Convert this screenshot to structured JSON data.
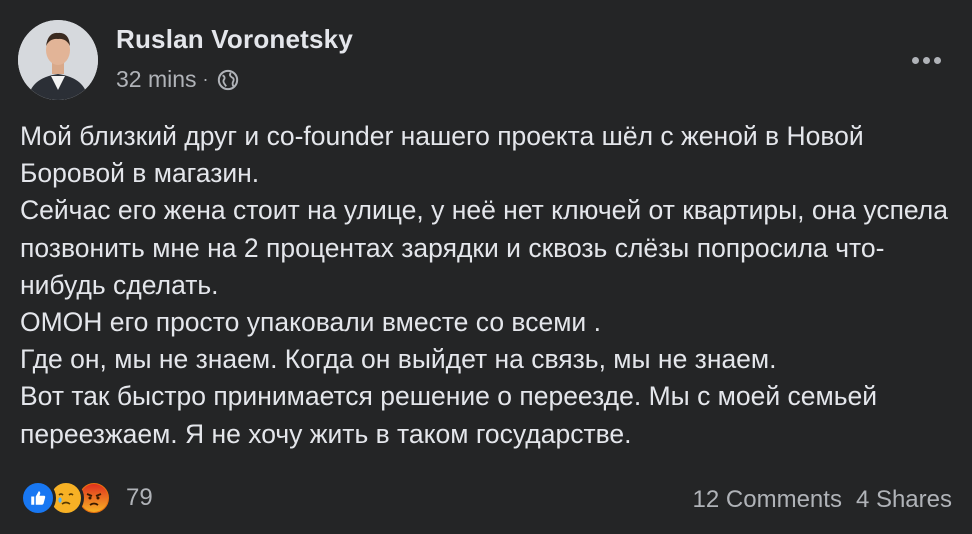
{
  "post": {
    "author": "Ruslan Voronetsky",
    "time": "32 mins",
    "separator": "·",
    "privacy_icon": "globe-icon",
    "paragraphs": [
      "Мой близкий друг и co-founder нашего проекта шёл с женой в Новой Боровой в магазин.",
      "Сейчас его жена стоит на улице, у неё нет ключей от квартиры, она успела позвонить мне на 2 процентах зарядки и сквозь слёзы попросила что-нибудь сделать.",
      "ОМОН его просто упаковали вместе со всеми .",
      "Где он, мы не знаем. Когда он выйдет на связь, мы не знаем.",
      "Вот так быстро принимается решение о переезде. Мы с моей семьей переезжаем. Я не хочу жить в таком государстве."
    ]
  },
  "reactions": {
    "icons": [
      "like-icon",
      "care-icon",
      "angry-icon"
    ],
    "count": "79"
  },
  "engagement": {
    "comments": "12 Comments",
    "shares": "4 Shares"
  },
  "colors": {
    "background": "#242526",
    "text_primary": "#e4e6eb",
    "text_secondary": "#b0b3b8",
    "like_blue": "#1877f2",
    "reaction_yellow": "#f7b125",
    "angry_red": "#e9710f"
  }
}
